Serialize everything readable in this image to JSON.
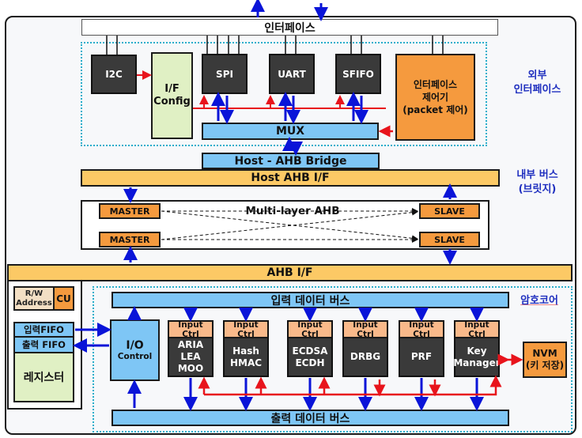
{
  "top_interface": {
    "label": "인터페이스"
  },
  "external_interface": {
    "side_label": "외부\n인터페이스",
    "blocks": {
      "i2c": "I2C",
      "if_config": "I/F\nConfig",
      "spi": "SPI",
      "uart": "UART",
      "sfifo": "SFIFO",
      "if_controller": "인터페이스\n제어기\n(packet 제어)"
    },
    "mux": "MUX"
  },
  "internal_bus": {
    "side_label": "내부 버스\n(브릿지)",
    "host_ahb_bridge": "Host - AHB Bridge",
    "host_ahb_if": "Host AHB I/F",
    "multilayer_ahb": "Multi-layer AHB",
    "master_1": "MASTER",
    "master_2": "MASTER",
    "slave_1": "SLAVE",
    "slave_2": "SLAVE",
    "ahb_if": "AHB I/F"
  },
  "register_block": {
    "rw_address": "R/W\nAddress",
    "cu": "CU",
    "input_fifo": "입력FIFO",
    "output_fifo": "출력 FIFO",
    "register": "레지스터"
  },
  "crypto_core": {
    "side_label": "암호코어",
    "input_data_bus": "입력 데이터 버스",
    "output_data_bus": "출력 데이터 버스",
    "io_control_title": "I/O",
    "io_control_sub": "Control",
    "input_ctrl_label": "Input Ctrl",
    "modules": [
      {
        "name": "ARIA\nLEA\nMOO"
      },
      {
        "name": "Hash\nHMAC"
      },
      {
        "name": "ECDSA\nECDH"
      },
      {
        "name": "DRBG"
      },
      {
        "name": "PRF"
      },
      {
        "name": "Key\nManager"
      }
    ],
    "nvm": "NVM\n(키 저장)"
  },
  "colors": {
    "data_arrow": "#0a14d8",
    "control_arrow": "#e8141c",
    "dotted_border": "#2aaecb",
    "bus_blue": "#7ec6f5",
    "bus_yellow": "#fcc965",
    "orange": "#f59a3e",
    "dark_block": "#3a3a3a",
    "config_green": "#e0f0c4",
    "side_label": "#1f2fbf"
  }
}
